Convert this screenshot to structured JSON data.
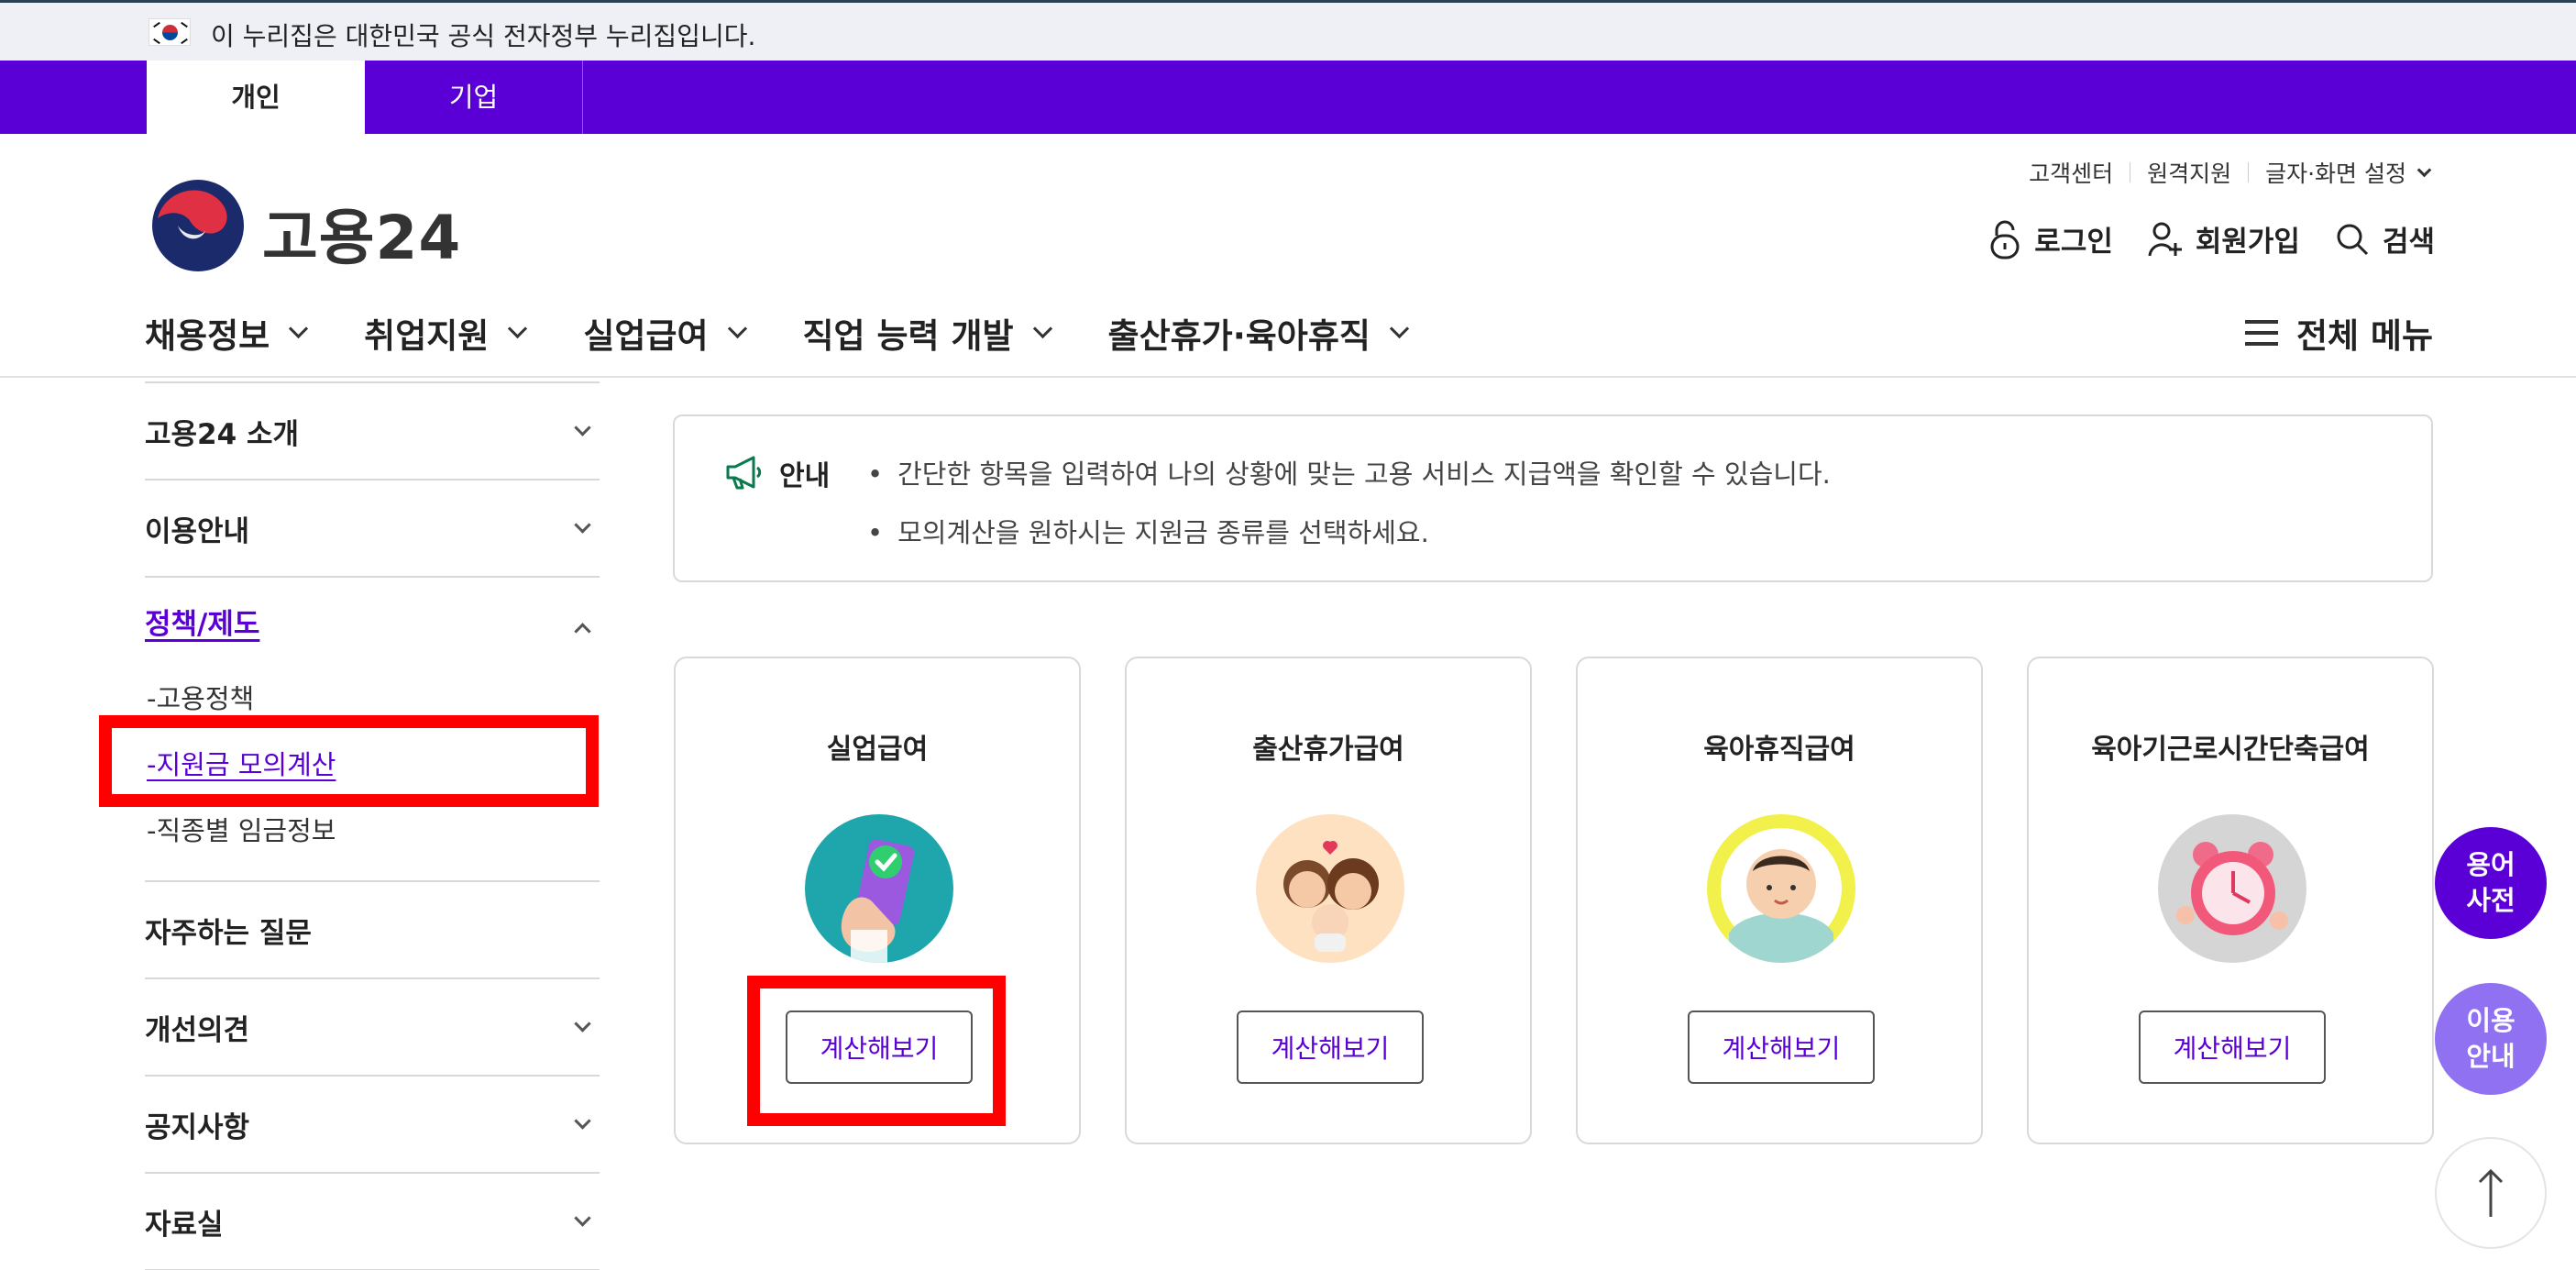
{
  "gov_banner": {
    "text": "이 누리집은 대한민국 공식 전자정부 누리집입니다."
  },
  "audience_tabs": [
    {
      "label": "개인",
      "active": true
    },
    {
      "label": "기업",
      "active": false
    }
  ],
  "header": {
    "brand": "고용24",
    "utility_links": [
      "고객센터",
      "원격지원",
      "글자·화면 설정"
    ],
    "actions": {
      "login": "로그인",
      "signup": "회원가입",
      "search": "검색"
    }
  },
  "gnb": {
    "items": [
      "채용정보",
      "취업지원",
      "실업급여",
      "직업 능력 개발",
      "출산휴가·육아휴직"
    ],
    "all_menu": "전체 메뉴"
  },
  "sidebar": {
    "items": [
      {
        "label": "고용24 소개"
      },
      {
        "label": "이용안내"
      },
      {
        "label": "정책/제도",
        "open": true
      },
      {
        "label": "자주하는 질문"
      },
      {
        "label": "개선의견"
      },
      {
        "label": "공지사항"
      },
      {
        "label": "자료실"
      }
    ],
    "sub_items": [
      "-고용정책",
      "-지원금 모의계산",
      "-직종별 임금정보"
    ]
  },
  "notice": {
    "label": "안내",
    "lines": [
      "간단한 항목을 입력하여 나의 상황에 맞는 고용 서비스 지급액을 확인할 수 있습니다.",
      "모의계산을 원하시는 지원금 종류를 선택하세요."
    ]
  },
  "cards": [
    {
      "title": "실업급여",
      "button": "계산해보기",
      "icon": "phone-check-icon",
      "bg": "#1fa6ad"
    },
    {
      "title": "출산휴가급여",
      "button": "계산해보기",
      "icon": "family-icon",
      "bg": "#fde1c0"
    },
    {
      "title": "육아휴직급여",
      "button": "계산해보기",
      "icon": "baby-icon",
      "bg": "#f2f04a"
    },
    {
      "title": "육아기근로시간단축급여",
      "button": "계산해보기",
      "icon": "alarm-clock-icon",
      "bg": "#d5d5d5"
    }
  ],
  "floating": {
    "glossary": "용어\n사전",
    "guide": "이용\n안내"
  },
  "colors": {
    "brand": "#5a00d6",
    "highlight": "#ff0000",
    "guide_button": "#8f71f2"
  }
}
